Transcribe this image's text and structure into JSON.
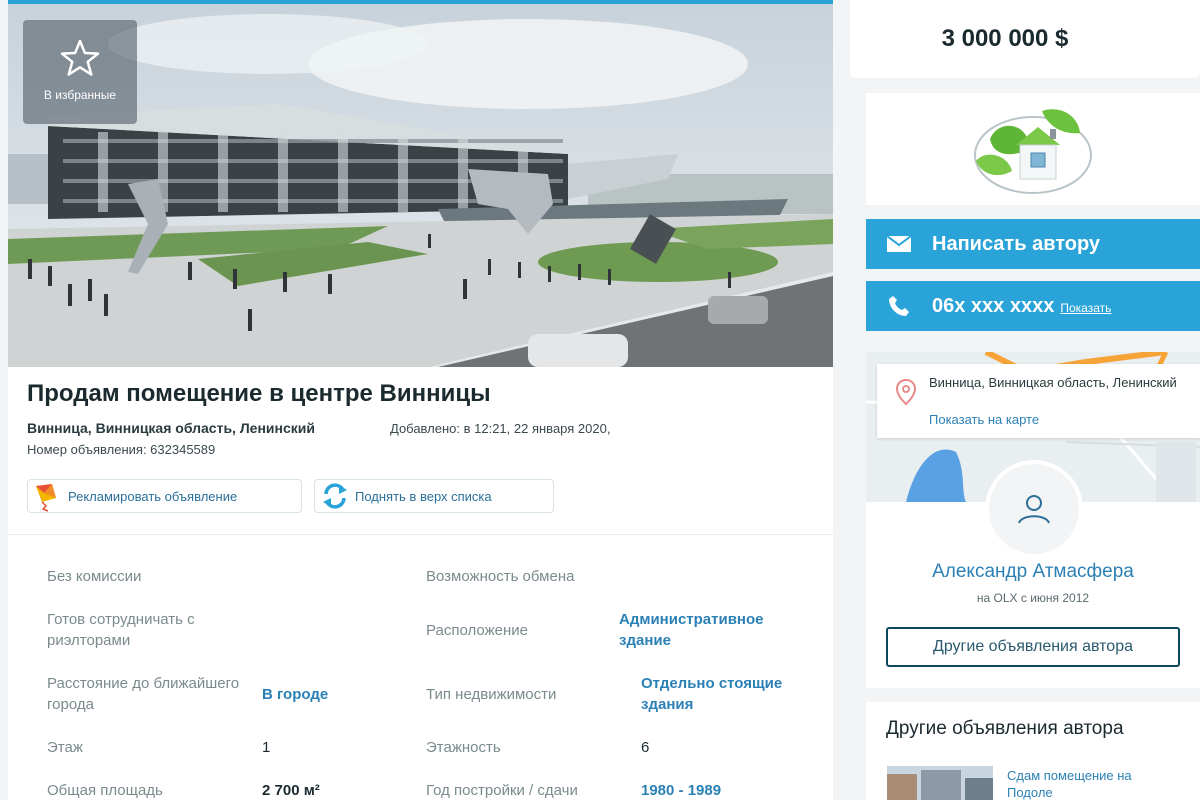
{
  "favorite": {
    "label": "В избранные",
    "icon": "star-icon"
  },
  "listing": {
    "title": "Продам помещение в центре Винницы",
    "location": "Винница, Винницкая область, Ленинский",
    "added": "Добавлено: в 12:21, 22 января 2020,",
    "ad_number": "Номер объявления: 632345589"
  },
  "promo": {
    "promote_label": "Рекламировать объявление",
    "lift_label": "Поднять в верх списка"
  },
  "params": {
    "no_commission": "Без комиссии",
    "exchange": "Возможность обмена",
    "realtors": "Готов сотрудничать с риэлторами",
    "location_k": "Расположение",
    "location_v": "Административное здание",
    "distance_k": "Расстояние до ближайшего города",
    "distance_v": "В городе",
    "type_k": "Тип недвижимости",
    "type_v": "Отдельно стоящие здания",
    "floor_k": "Этаж",
    "floor_v": "1",
    "floors_k": "Этажность",
    "floors_v": "6",
    "area_k": "Общая площадь",
    "area_v": "2 700 м²",
    "year_k": "Год постройки / сдачи",
    "year_v": "1980 - 1989"
  },
  "price": "3 000 000 $",
  "contact": {
    "write_label": "Написать автору",
    "phone": "06x xxx xxxx",
    "show_label": "Показать"
  },
  "map": {
    "address": "Винница, Винницкая область, Ленинский",
    "show_on_map": "Показать на карте"
  },
  "seller": {
    "name": "Александр Атмасфера",
    "since": "на OLX с июня 2012",
    "other_ads_button": "Другие объявления автора"
  },
  "other_ads": {
    "heading": "Другие объявления автора",
    "items": [
      {
        "title": "Сдам помещение на Подоле"
      }
    ]
  },
  "colors": {
    "accent": "#2aa3d8",
    "link": "#2b81b6",
    "dark": "#002f34"
  }
}
